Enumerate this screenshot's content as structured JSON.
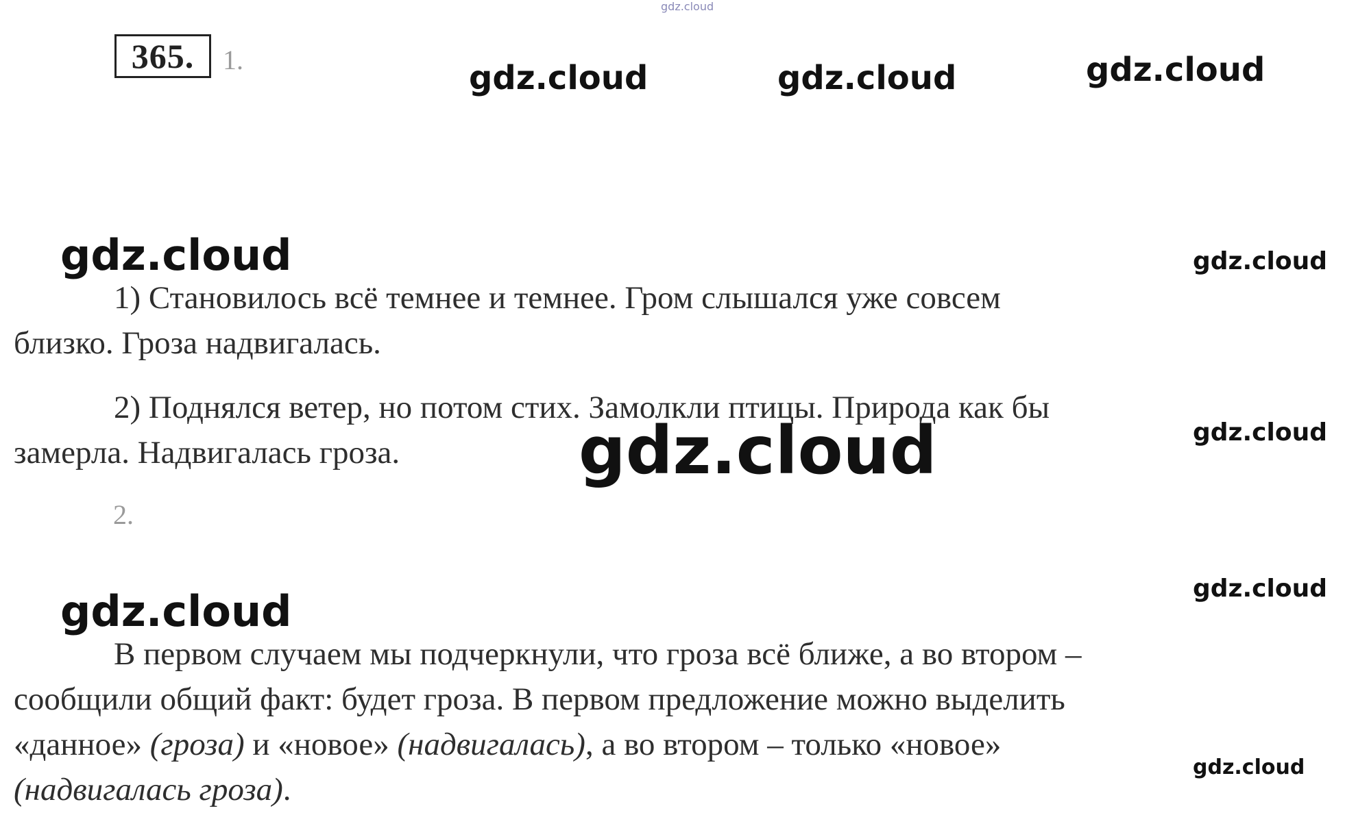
{
  "watermarks": {
    "tiny": "gdz.cloud",
    "top_1": "gdz.cloud",
    "top_2": "gdz.cloud",
    "top_3": "gdz.cloud",
    "left_1": "gdz.cloud",
    "left_2": "gdz.cloud",
    "right_1": "gdz.cloud",
    "right_2": "gdz.cloud",
    "right_3": "gdz.cloud",
    "right_4": "gdz.cloud",
    "big": "gdz.cloud"
  },
  "exercise": {
    "number": "365.",
    "part1_label": "1.",
    "part2_label": "2."
  },
  "part1": {
    "item1_line1": "1) Становилось всё темнее и темнее. Гром слышался уже совсем",
    "item1_line2": "близко. Гроза надвигалась.",
    "item2_line1": "2) Поднялся ветер, но потом стих. Замолкли птицы. Природа как бы",
    "item2_line2": "замерла. Надвигалась гроза."
  },
  "part2": {
    "line1": "В первом случаем мы подчеркнули, что гроза всё ближе, а во втором –",
    "line2": "сообщили общий факт: будет гроза. В первом предложение можно выделить",
    "line3_a": "«данное» ",
    "line3_b": "(гроза)",
    "line3_c": " и «новое» ",
    "line3_d": "(надвигалась)",
    "line3_e": ", а во втором – только «новое»",
    "line4_a": "(надвигалась гроза)",
    "line4_b": "."
  }
}
